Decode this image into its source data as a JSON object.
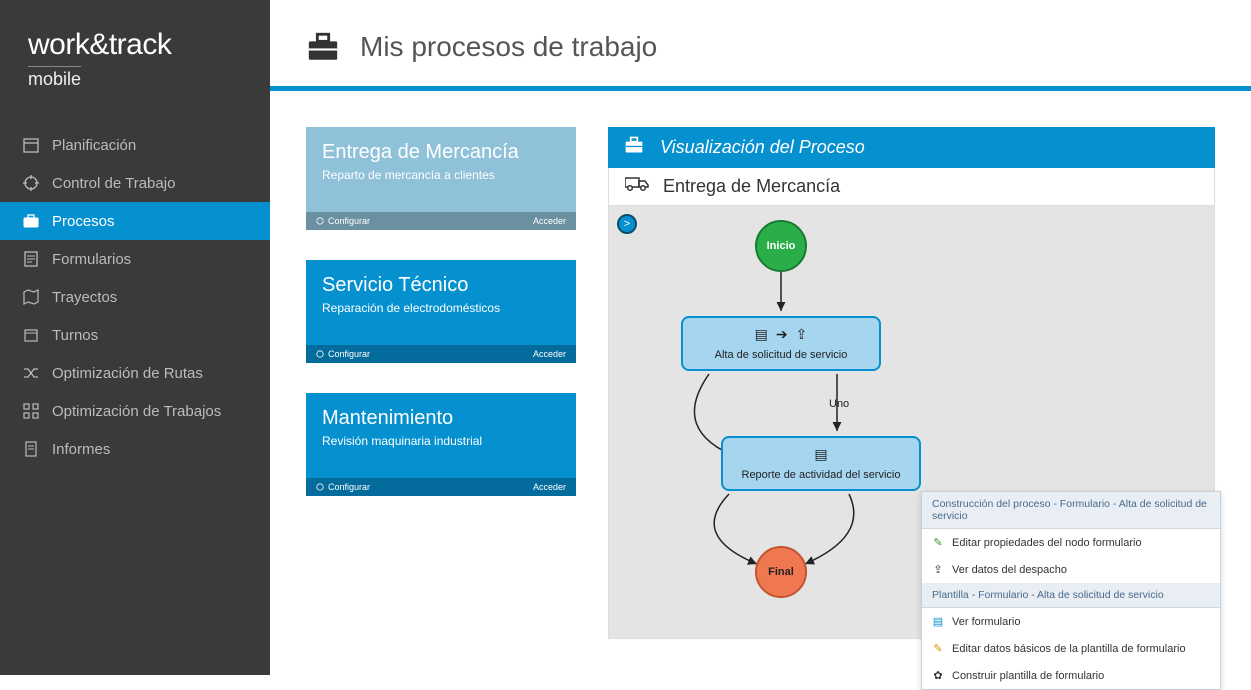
{
  "brand": {
    "main": "work&track",
    "sub": "mobile"
  },
  "nav": [
    {
      "label": "Planificación",
      "icon": "calendar"
    },
    {
      "label": "Control de Trabajo",
      "icon": "target"
    },
    {
      "label": "Procesos",
      "icon": "briefcase",
      "active": true
    },
    {
      "label": "Formularios",
      "icon": "form"
    },
    {
      "label": "Trayectos",
      "icon": "map"
    },
    {
      "label": "Turnos",
      "icon": "clock"
    },
    {
      "label": "Optimización de Rutas",
      "icon": "shuffle"
    },
    {
      "label": "Optimización de Trabajos",
      "icon": "grid"
    },
    {
      "label": "Informes",
      "icon": "report"
    }
  ],
  "header": {
    "title": "Mis procesos de trabajo"
  },
  "cards": [
    {
      "title": "Entrega de Mercancía",
      "sub": "Reparto de mercancía a clientes",
      "variant": "light",
      "configure": "Configurar",
      "access": "Acceder"
    },
    {
      "title": "Servicio Técnico",
      "sub": "Reparación de electrodomésticos",
      "variant": "blue",
      "configure": "Configurar",
      "access": "Acceder"
    },
    {
      "title": "Mantenimiento",
      "sub": "Revisión maquinaria industrial",
      "variant": "blue",
      "configure": "Configurar",
      "access": "Acceder"
    }
  ],
  "panel": {
    "title": "Visualización del Proceso",
    "subtitle": "Entrega de Mercancía"
  },
  "diagram": {
    "start": "Inicio",
    "box1": "Alta de solicitud de servicio",
    "edge": "Uno",
    "box2": "Reporte de actividad del servicio",
    "end": "Final"
  },
  "context": {
    "h1": "Construcción del proceso - Formulario - Alta de solicitud de servicio",
    "i1": "Editar propiedades del nodo formulario",
    "i2": "Ver datos del despacho",
    "h2": "Plantilla - Formulario - Alta de solicitud de servicio",
    "i3": "Ver formulario",
    "i4": "Editar datos básicos de la plantilla de formulario",
    "i5": "Construir plantilla de formulario"
  },
  "colors": {
    "accent": "#0590d0",
    "sidebar": "#3a3a3a"
  }
}
